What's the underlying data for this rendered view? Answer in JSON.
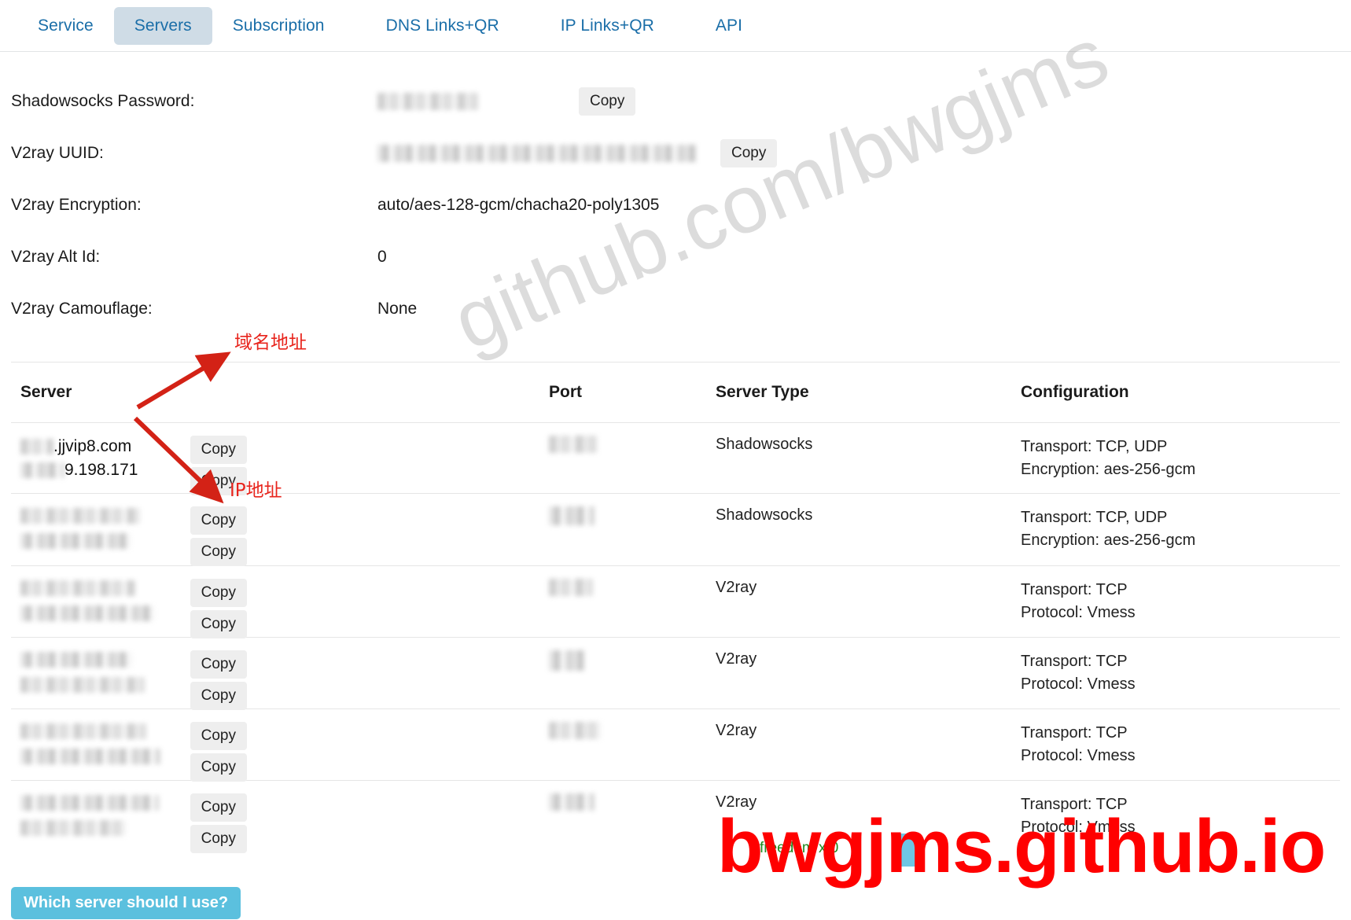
{
  "tabs": [
    {
      "label": "Service",
      "active": false
    },
    {
      "label": "Servers",
      "active": true
    },
    {
      "label": "Subscription",
      "active": false
    },
    {
      "label": "DNS Links+QR",
      "active": false
    },
    {
      "label": "IP Links+QR",
      "active": false
    },
    {
      "label": "API",
      "active": false
    }
  ],
  "info": [
    {
      "label": "Shadowsocks Password:",
      "value": "",
      "redacted": true,
      "redacted_width": 128,
      "copy": "Copy"
    },
    {
      "label": "V2ray UUID:",
      "value": "",
      "redacted": true,
      "redacted_width": 406,
      "copy": "Copy"
    },
    {
      "label": "V2ray Encryption:",
      "value": "auto/aes-128-gcm/chacha20-poly1305",
      "redacted": false,
      "copy": ""
    },
    {
      "label": "V2ray Alt Id:",
      "value": "0",
      "redacted": false,
      "copy": ""
    },
    {
      "label": "V2ray Camouflage:",
      "value": "None",
      "redacted": false,
      "copy": ""
    }
  ],
  "table": {
    "headers": {
      "server": "Server",
      "port": "Port",
      "type": "Server Type",
      "config": "Configuration"
    },
    "copy_label": "Copy",
    "rows": [
      {
        "server_domain": ".jjvip8.com",
        "server_ip": "9.198.171",
        "domain_redacted": true,
        "ip_redacted": true,
        "port": "",
        "type": "Shadowsocks",
        "config_line1": "Transport: TCP, UDP",
        "config_line2": "Encryption: aes-256-gcm"
      },
      {
        "server_domain": "",
        "server_ip": "",
        "domain_redacted": true,
        "ip_redacted": true,
        "port": "",
        "type": "Shadowsocks",
        "config_line1": "Transport: TCP, UDP",
        "config_line2": "Encryption: aes-256-gcm"
      },
      {
        "server_domain": "",
        "server_ip": "",
        "domain_redacted": true,
        "ip_redacted": true,
        "port": "",
        "type": "V2ray",
        "config_line1": "Transport: TCP",
        "config_line2": "Protocol: Vmess"
      },
      {
        "server_domain": "",
        "server_ip": "",
        "domain_redacted": true,
        "ip_redacted": true,
        "port": "",
        "type": "V2ray",
        "config_line1": "Transport: TCP",
        "config_line2": "Protocol: Vmess"
      },
      {
        "server_domain": "",
        "server_ip": "",
        "domain_redacted": true,
        "ip_redacted": true,
        "port": "",
        "type": "V2ray",
        "config_line1": "Transport: TCP",
        "config_line2": "Protocol: Vmess"
      },
      {
        "server_domain": "",
        "server_ip": "",
        "domain_redacted": true,
        "ip_redacted": true,
        "port": "",
        "type": "V2ray",
        "config_line1": "Transport: TCP",
        "config_line2": "Protocol: Vmess"
      }
    ]
  },
  "annotations": {
    "domain_label": "域名地址",
    "ip_label": "IP地址",
    "arrow_color": "#d32216"
  },
  "overlays": {
    "watermark_diagonal": "github.com/bwgjms",
    "watermark_red": "bwgjms.github.io",
    "green_note": "freedom x 0"
  },
  "bottom": {
    "help_button": "Which server should I use?"
  },
  "colors": {
    "tab_link": "#1a6ea8",
    "tab_active_bg": "#cfdce6",
    "annotation_red": "#e8241c",
    "help_button_bg": "#5bc0de",
    "green_note": "#1f8a1f",
    "watermark_red": "#ff0000"
  }
}
